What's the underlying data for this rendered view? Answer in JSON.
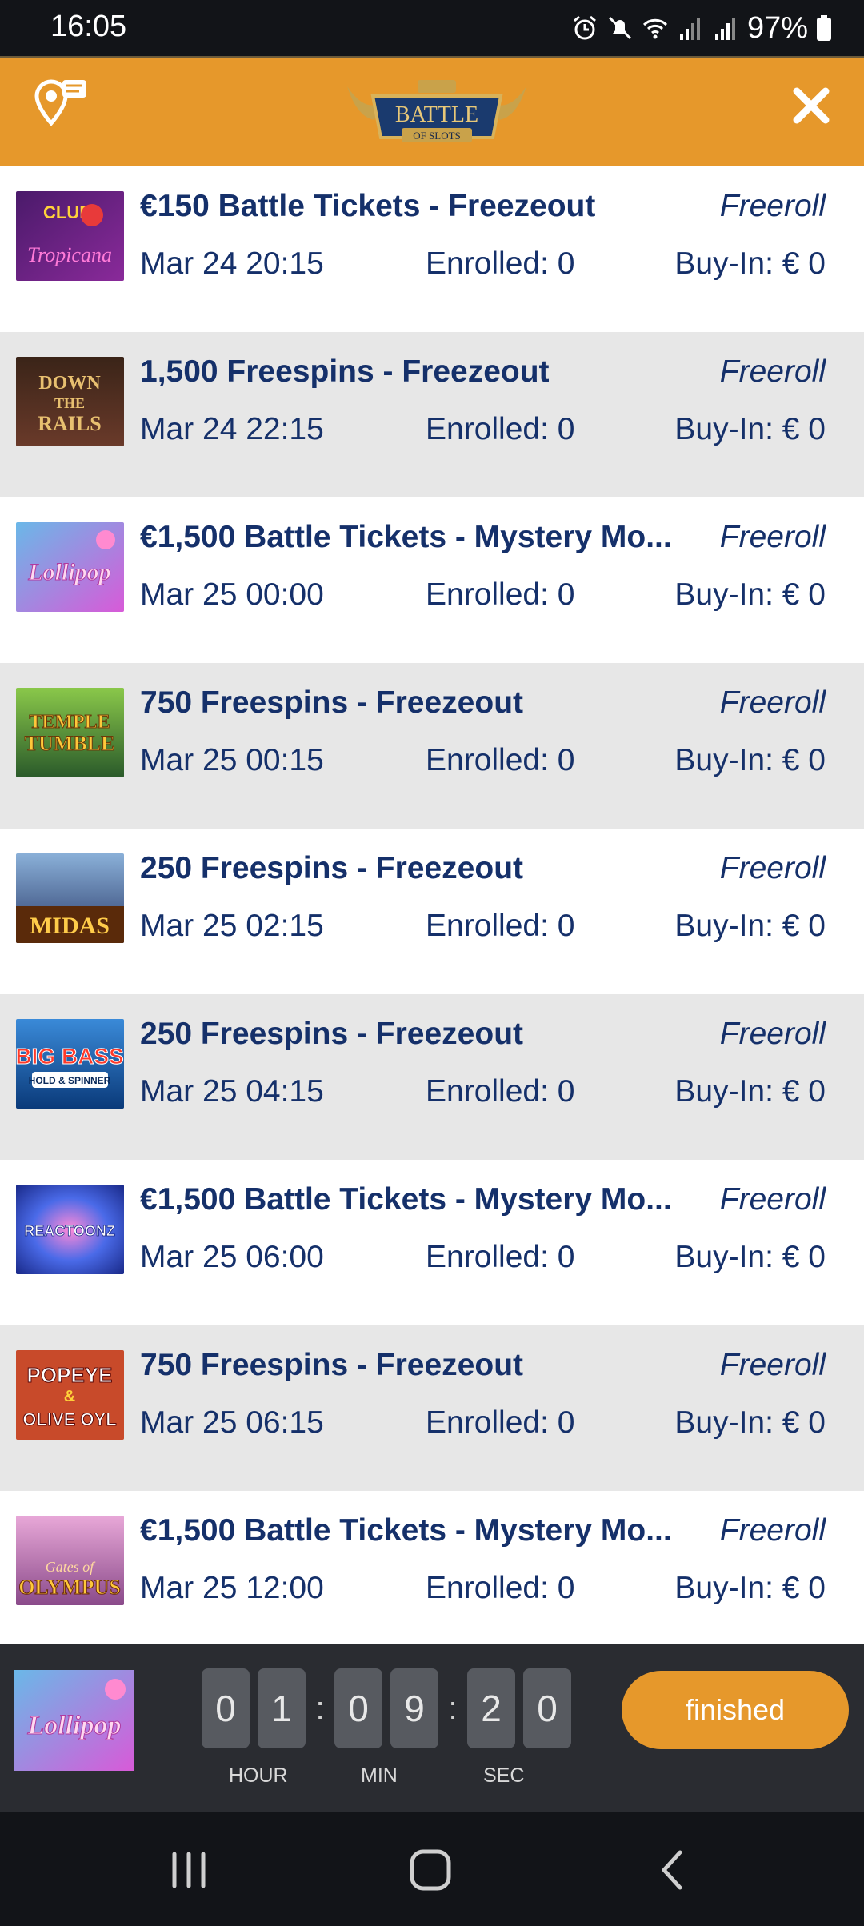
{
  "status_bar": {
    "time": "16:05",
    "battery": "97%",
    "icons": [
      "alarm-icon",
      "mute-icon",
      "wifi-icon",
      "signal-icon",
      "signal-icon",
      "battery-icon"
    ]
  },
  "header": {
    "logo_text_line1": "BATTLE",
    "logo_text_line2": "OF SLOTS",
    "background_color": "#e6982b"
  },
  "tournaments": [
    {
      "thumb_text": "Tropicana",
      "thumb_color": "#6a2a8c",
      "title": "€150 Battle Tickets - Freezeout",
      "type": "Freeroll",
      "date": "Mar 24 20:15",
      "enrolled": "Enrolled: 0",
      "buyin": "Buy-In: € 0"
    },
    {
      "thumb_text": "DOWN THE RAILS",
      "thumb_color": "#5a3a1e",
      "title": "1,500 Freespins - Freezeout",
      "type": "Freeroll",
      "date": "Mar 24 22:15",
      "enrolled": "Enrolled: 0",
      "buyin": "Buy-In: € 0"
    },
    {
      "thumb_text": "Lollipop",
      "thumb_color": "#c85cc8",
      "title": "€1,500 Battle Tickets - Mystery Mo...",
      "type": "Freeroll",
      "date": "Mar 25 00:00",
      "enrolled": "Enrolled: 0",
      "buyin": "Buy-In: € 0"
    },
    {
      "thumb_text": "TEMPLE TUMBLE",
      "thumb_color": "#3f6a2a",
      "title": "750 Freespins - Freezeout",
      "type": "Freeroll",
      "date": "Mar 25 00:15",
      "enrolled": "Enrolled: 0",
      "buyin": "Buy-In: € 0"
    },
    {
      "thumb_text": "MIDAS",
      "thumb_color": "#5a7aa8",
      "title": "250 Freespins - Freezeout",
      "type": "Freeroll",
      "date": "Mar 25 02:15",
      "enrolled": "Enrolled: 0",
      "buyin": "Buy-In: € 0"
    },
    {
      "thumb_text": "BIG BASS",
      "thumb_color": "#1e5aa8",
      "title": "250 Freespins - Freezeout",
      "type": "Freeroll",
      "date": "Mar 25 04:15",
      "enrolled": "Enrolled: 0",
      "buyin": "Buy-In: € 0"
    },
    {
      "thumb_text": "REACTOONZ",
      "thumb_color": "#3a4ec8",
      "title": "€1,500 Battle Tickets - Mystery Mo...",
      "type": "Freeroll",
      "date": "Mar 25 06:00",
      "enrolled": "Enrolled: 0",
      "buyin": "Buy-In: € 0"
    },
    {
      "thumb_text": "POPEYE & OLIVE OYL",
      "thumb_color": "#b83a2a",
      "title": "750 Freespins - Freezeout",
      "type": "Freeroll",
      "date": "Mar 25 06:15",
      "enrolled": "Enrolled: 0",
      "buyin": "Buy-In: € 0"
    },
    {
      "thumb_text": "OLYMPUS",
      "thumb_color": "#c87a4a",
      "title": "€1,500 Battle Tickets - Mystery Mo...",
      "type": "Freeroll",
      "date": "Mar 25 12:00",
      "enrolled": "Enrolled: 0",
      "buyin": "Buy-In: € 0"
    }
  ],
  "countdown": {
    "game_thumb_text": "Lollipop",
    "hour_digits": [
      "0",
      "1"
    ],
    "min_digits": [
      "0",
      "9"
    ],
    "sec_digits": [
      "2",
      "0"
    ],
    "hour_label": "HOUR",
    "min_label": "MIN",
    "sec_label": "SEC",
    "button_label": "finished"
  },
  "nav": {
    "icons": [
      "recents-icon",
      "home-icon",
      "back-icon"
    ]
  }
}
